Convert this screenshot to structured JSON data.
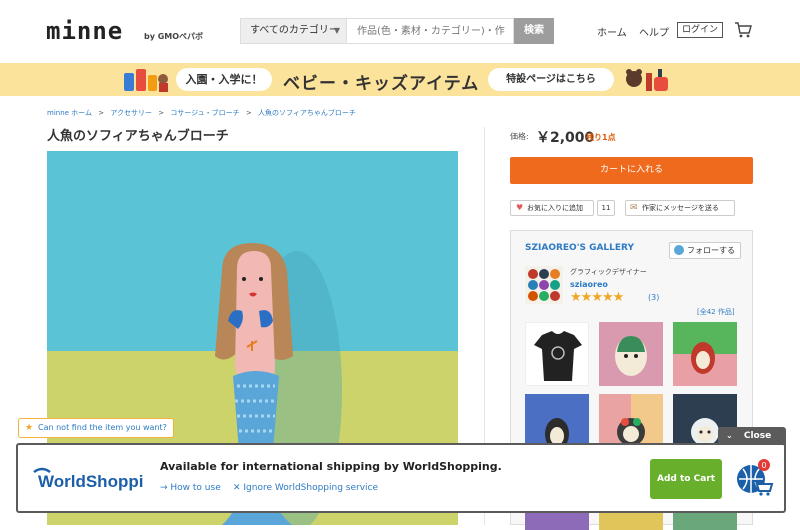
{
  "header": {
    "logo": "minne",
    "logo_sub": "by GMOペパボ",
    "category_select": "すべてのカテゴリー",
    "search_placeholder": "作品(色・素材・カテゴリー)・作",
    "search_button": "検索",
    "nav_home": "ホーム",
    "nav_help": "ヘルプ",
    "nav_login": "ログイン"
  },
  "banner": {
    "pill_left": "入園・入学に！",
    "title": "ベビー・キッズアイテム",
    "pill_right": "特設ページはこちら"
  },
  "breadcrumb": [
    "minne ホーム",
    "アクセサリー",
    "コサージュ・ブローチ",
    "人魚のソフィアちゃんブローチ"
  ],
  "product": {
    "title": "人魚のソフィアちゃんブローチ",
    "price_label": "価格:",
    "price": "￥2,000",
    "stock": "残り1点",
    "cart_button": "カートに入れる",
    "favorite_button": "お気に入りに追加",
    "favorite_count": "11",
    "message_button": "作家にメッセージを送る"
  },
  "gallery": {
    "name": "SZIAOREO'S GALLERY",
    "follow_button": "フォローする",
    "creator_role": "グラフィックデザイナー",
    "creator_name": "sziaoreo",
    "rating": 5,
    "review_count": "(3)",
    "work_count": "[全42 作品]"
  },
  "worldshopping": {
    "help_tip": "Can not find the item you want?",
    "close_label": "Close",
    "logo_text": "WorldShopping",
    "title": "Available for international shipping by WorldShopping.",
    "how_to_use": "How to use",
    "ignore": "Ignore WorldShopping service",
    "add_to_cart": "Add to Cart",
    "cart_badge": "0"
  },
  "colors": {
    "accent_orange": "#f06a1e",
    "link_blue": "#2e7bc4",
    "banner_yellow": "#fce39b",
    "product_bg_top": "#5bc3d6",
    "product_bg_bottom": "#cdd36b",
    "add_to_cart_green": "#68b02c"
  }
}
